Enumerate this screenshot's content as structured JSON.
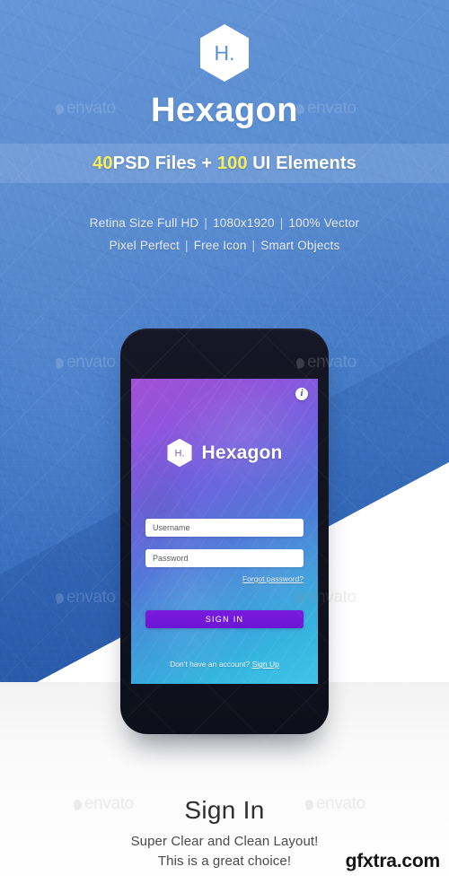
{
  "hero": {
    "logo_letter": "H.",
    "brand_title": "Hexagon",
    "strip": {
      "psd_count": "40",
      "psd_label": "PSD Files + ",
      "ui_count": "100",
      "ui_label": "UI Elements"
    },
    "specs": [
      {
        "parts": [
          "Retina Size Full HD",
          "1080x1920",
          "100% Vector"
        ]
      },
      {
        "parts": [
          "Pixel Perfect",
          "Free Icon",
          "Smart Objects"
        ]
      }
    ],
    "spec_line_1_a": "Retina Size Full HD",
    "spec_line_1_b": "1080x1920",
    "spec_line_1_c": "100% Vector",
    "spec_line_2_a": "Pixel Perfect",
    "spec_line_2_b": "Free Icon",
    "spec_line_2_c": "Smart Objects",
    "separator": "|"
  },
  "phone": {
    "info_icon_label": "i",
    "app_logo_letter": "H.",
    "app_name": "Hexagon",
    "username_placeholder": "Username",
    "password_placeholder": "Password",
    "username_value": "",
    "password_value": "",
    "forgot_label": "Forgot password?",
    "signin_label": "SIGN IN",
    "signup_prompt": "Don't have an account?",
    "signup_link": "Sign Up"
  },
  "footer": {
    "title": "Sign In",
    "sub_line_1": "Super Clear and Clean Layout!",
    "sub_line_2": "This is a great choice!",
    "site_watermark": "gfxtra.com"
  },
  "watermarks": {
    "envato": "envato"
  },
  "colors": {
    "hero_blue_top": "#5b8fd4",
    "hero_blue_bottom": "#2f62b4",
    "strip_overlay": "rgba(255,255,255,0.13)",
    "highlight_yellow": "#f7ef5a",
    "phone_body": "#11131f",
    "screen_purple": "#a24fd6",
    "screen_cyan": "#3fc4e6",
    "signin_purple": "#7a1ae0",
    "footer_text": "#2f2f2f",
    "white": "#ffffff"
  }
}
